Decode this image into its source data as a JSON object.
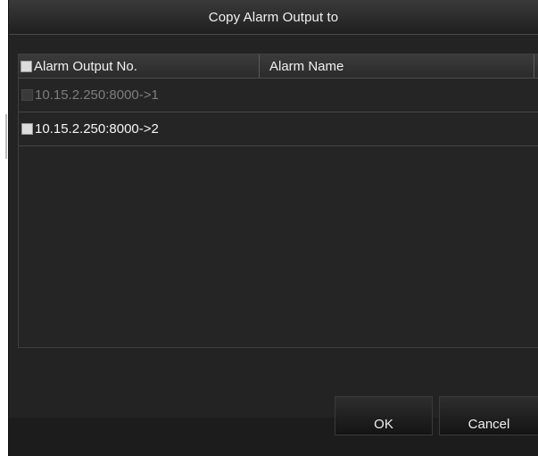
{
  "dialog": {
    "title": "Copy Alarm Output to"
  },
  "table": {
    "columns": [
      "Alarm Output No.",
      "Alarm Name"
    ],
    "rows": [
      {
        "label": "10.15.2.250:8000->1",
        "enabled": false,
        "checked": false
      },
      {
        "label": "10.15.2.250:8000->2",
        "enabled": true,
        "checked": false
      }
    ]
  },
  "buttons": {
    "ok": "OK",
    "cancel": "Cancel"
  }
}
